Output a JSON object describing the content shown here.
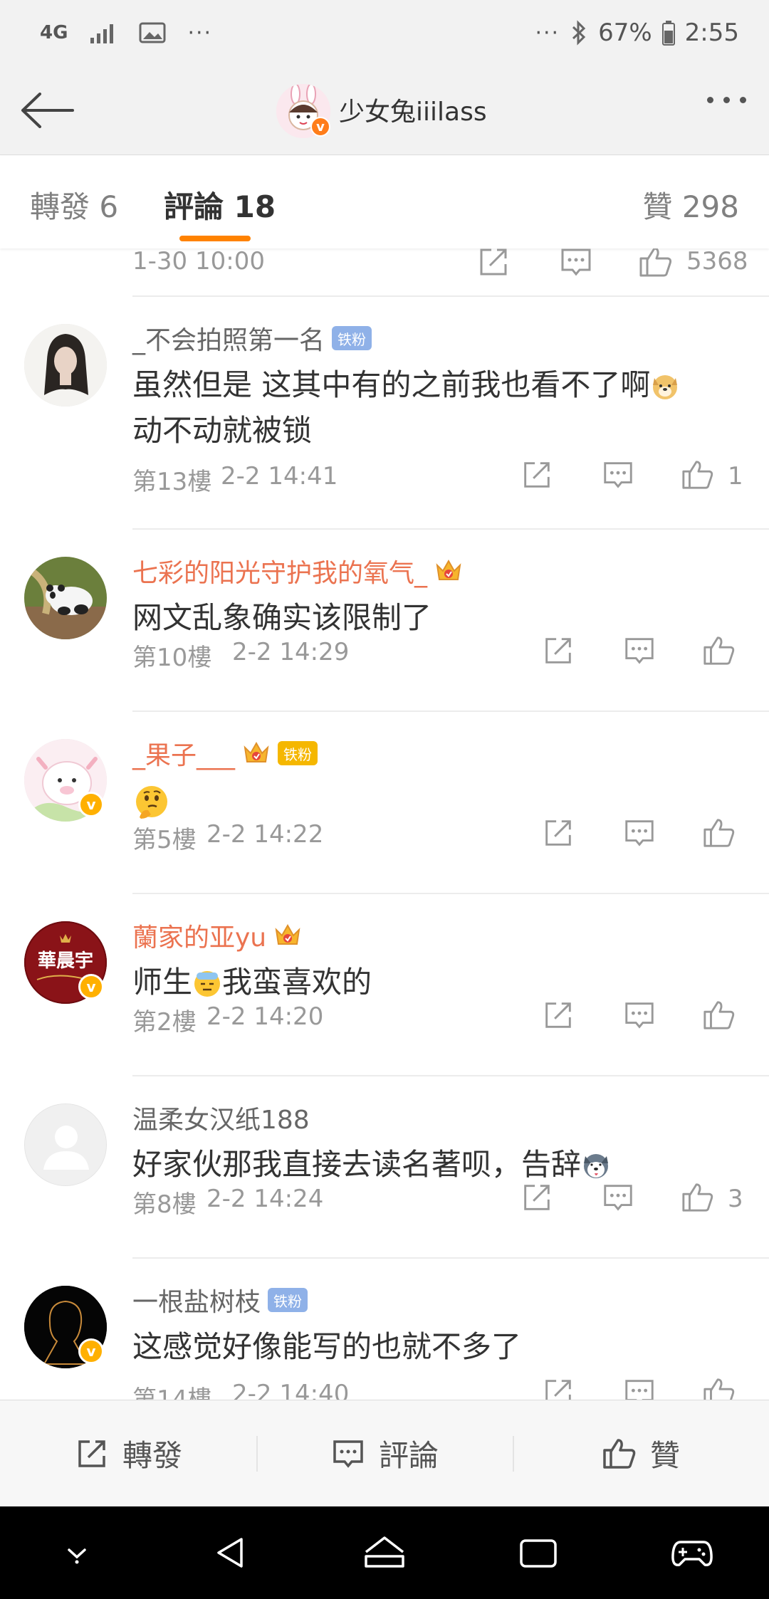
{
  "status_bar": {
    "network": "4G",
    "battery": "67%",
    "time": "2:55"
  },
  "header": {
    "title": "少女兔iiilass"
  },
  "tabs": [
    {
      "label": "轉發 6"
    },
    {
      "label": "評論 18"
    },
    {
      "label": "贊 298"
    }
  ],
  "previous_row": {
    "time": "1-30 10:00",
    "likes": "5368"
  },
  "comments": [
    {
      "name": "_不会拍照第一名",
      "badge": "铁粉",
      "text_line1": "虽然但是 这其中有的之前我也看不了啊",
      "text_line2": "动不动就被锁",
      "floor": "第13樓",
      "time": "2-2 14:41",
      "likes": "1"
    },
    {
      "name": "七彩的阳光守护我的氧气_",
      "text": "网文乱象确实该限制了",
      "floor": "第10樓",
      "time": "2-2 14:29"
    },
    {
      "name": "_果子___",
      "badge": "铁粉",
      "floor": "第5樓",
      "time": "2-2 14:22"
    },
    {
      "name": "蘭家的亚yu",
      "text_a": "师生",
      "text_b": "我蛮喜欢的",
      "avatar_text": "華晨宇",
      "floor": "第2樓",
      "time": "2-2 14:20"
    },
    {
      "name": "温柔女汉纸188",
      "text": "好家伙那我直接去读名著呗，告辞",
      "floor": "第8樓",
      "time": "2-2 14:24",
      "likes": "3"
    },
    {
      "name": "一根盐树枝",
      "badge": "铁粉",
      "text": "这感觉好像能写的也就不多了",
      "floor": "第14樓",
      "time": "2-2 14:40"
    }
  ],
  "toolbar": {
    "repost": "轉發",
    "comment": "評論",
    "like": "贊"
  },
  "colors": {
    "accent": "#ff8200",
    "vip_name": "#eb7350",
    "fan_badge": "#8fb1e8"
  }
}
